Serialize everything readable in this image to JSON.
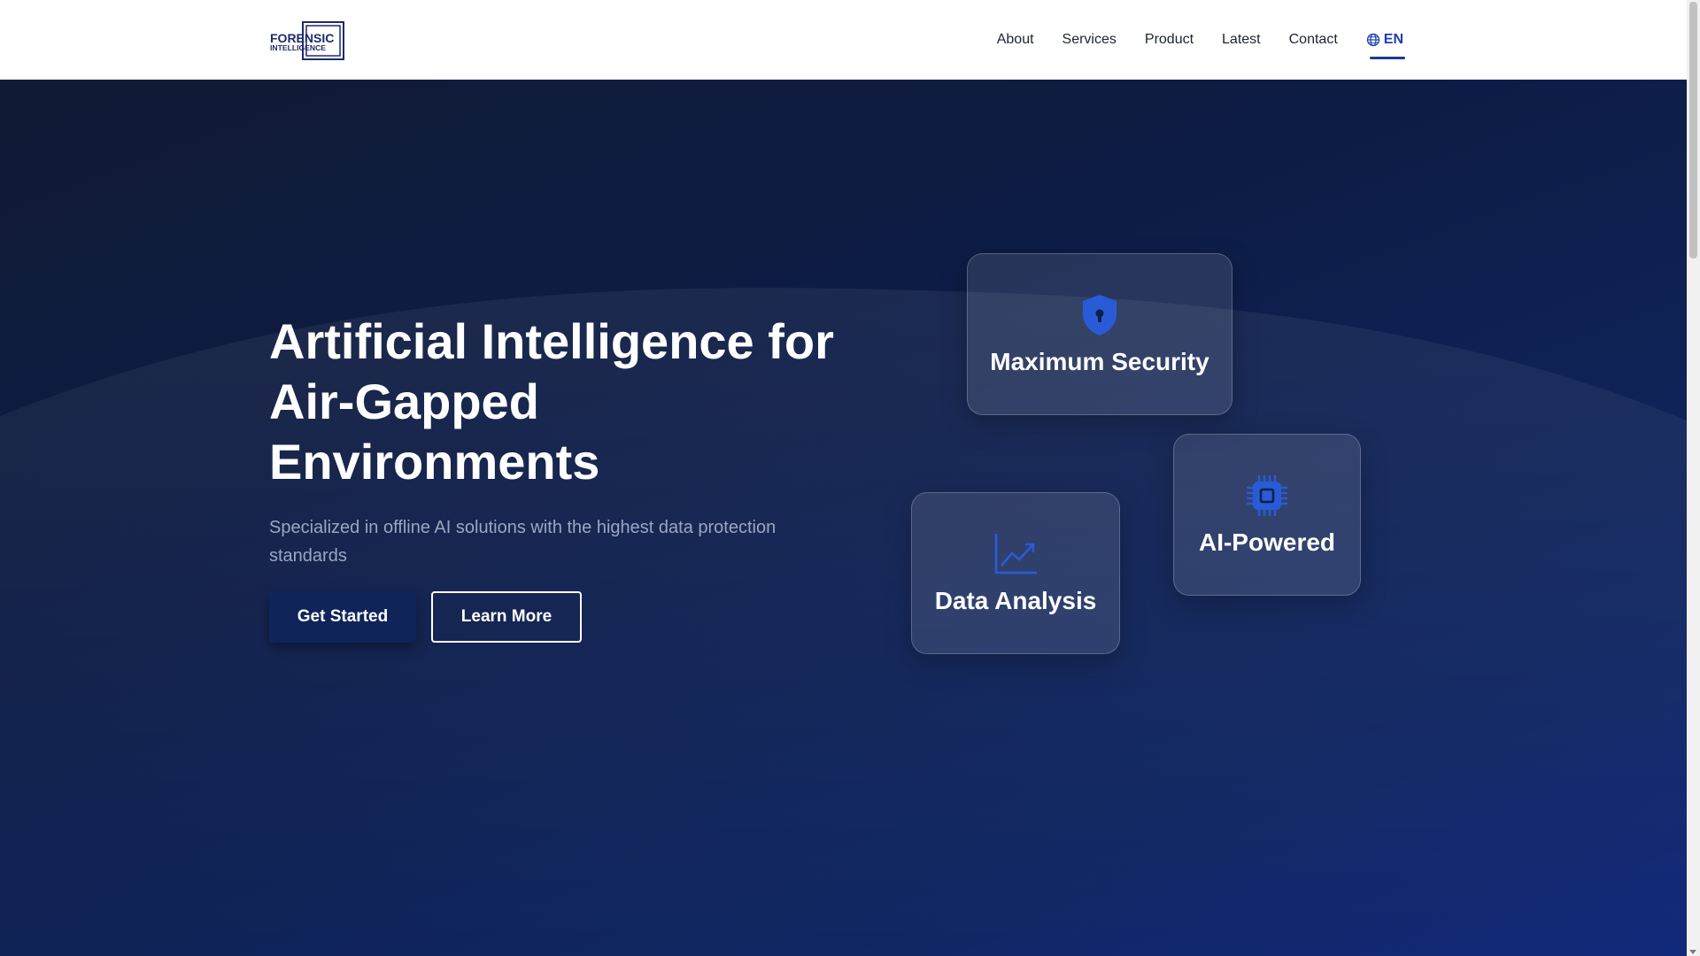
{
  "header": {
    "logo": {
      "line1": "FORENSIC",
      "line2": "INTELLIGENCE",
      "icon": "logo-squares"
    },
    "nav": [
      {
        "label": "About"
      },
      {
        "label": "Services"
      },
      {
        "label": "Product"
      },
      {
        "label": "Latest"
      },
      {
        "label": "Contact"
      }
    ],
    "language": {
      "label": "EN",
      "icon": "globe-icon"
    }
  },
  "hero": {
    "title": "Artificial Intelligence for Air-Gapped Environments",
    "subtitle": "Specialized in offline AI solutions with the highest data protection standards",
    "primary_button": "Get Started",
    "secondary_button": "Learn More",
    "cards": [
      {
        "label": "Maximum Security",
        "icon": "shield-lock-icon"
      },
      {
        "label": "AI-Powered",
        "icon": "chip-icon"
      },
      {
        "label": "Data Analysis",
        "icon": "trending-chart-icon"
      }
    ]
  },
  "colors": {
    "accent": "#1e3a8a",
    "icon_blue": "#2a5bd7",
    "hero_bg": "#0d1c45"
  }
}
